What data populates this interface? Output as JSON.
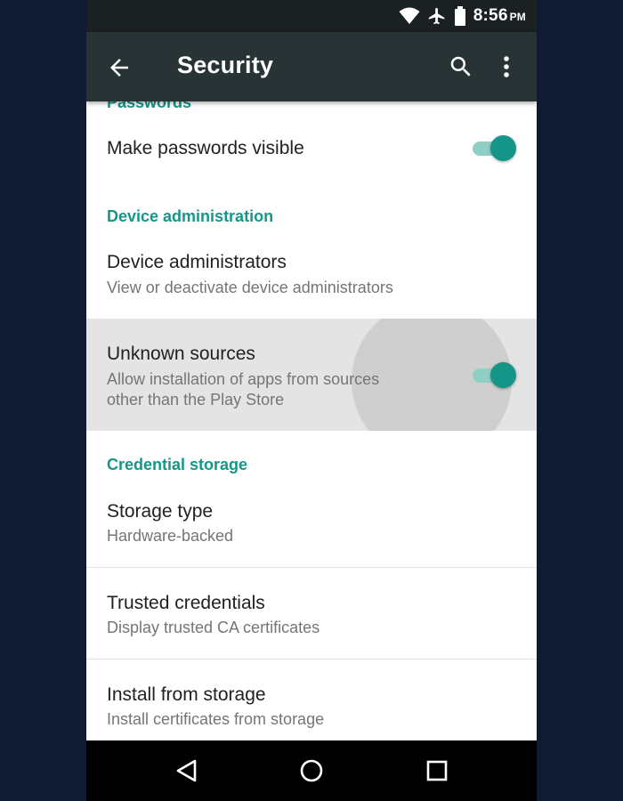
{
  "status_bar": {
    "time": "8:56",
    "ampm": "PM",
    "icons": [
      "wifi-icon",
      "airplane-icon",
      "battery-icon"
    ]
  },
  "toolbar": {
    "title": "Security",
    "icons": [
      "back-arrow-icon",
      "search-icon",
      "more-vert-icon"
    ]
  },
  "sections": {
    "passwords": {
      "header": "Passwords",
      "make_visible": {
        "title": "Make passwords visible",
        "enabled": true
      }
    },
    "device_admin": {
      "header": "Device administration",
      "administrators": {
        "title": "Device administrators",
        "subtitle": "View or deactivate device administrators"
      },
      "unknown_sources": {
        "title": "Unknown sources",
        "subtitle_line1": "Allow installation of apps from sources",
        "subtitle_line2": "other than the Play Store",
        "enabled": true
      }
    },
    "credential_storage": {
      "header": "Credential storage",
      "storage_type": {
        "title": "Storage type",
        "subtitle": "Hardware-backed"
      },
      "trusted_credentials": {
        "title": "Trusted credentials",
        "subtitle": "Display trusted CA certificates"
      },
      "install_from_storage": {
        "title": "Install from storage",
        "subtitle": "Install certificates from storage"
      }
    }
  },
  "colors": {
    "accent": "#159688",
    "toolbar": "#283336",
    "status_bar": "#1b2123",
    "background": "#101a30"
  },
  "nav_bar": {
    "icons": [
      "back-triangle-icon",
      "home-circle-icon",
      "recents-square-icon"
    ]
  }
}
